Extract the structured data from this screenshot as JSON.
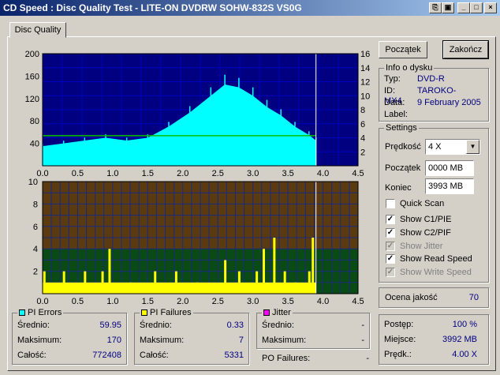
{
  "window": {
    "title": "CD Speed : Disc Quality Test - LITE-ON DVDRW SOHW-832S VS0G"
  },
  "tab": {
    "label": "Disc Quality"
  },
  "buttons": {
    "start": "Początek",
    "stop": "Zakończ"
  },
  "disc_info": {
    "legend": "Info o dysku",
    "type_label": "Typ:",
    "type_value": "DVD-R",
    "id_label": "ID:",
    "id_value": "TAROKO-MX4",
    "date_label": "Data:",
    "date_value": "9 February 2005",
    "label_label": "Label:"
  },
  "settings": {
    "legend": "Settings",
    "speed_label": "Prędkość",
    "speed_value": "4 X",
    "start_label": "Początek",
    "start_value": "0000 MB",
    "end_label": "Koniec",
    "end_value": "3993 MB",
    "quick_scan": "Quick Scan",
    "show_c1": "Show C1/PIE",
    "show_c2": "Show C2/PIF",
    "show_jitter": "Show Jitter",
    "show_read": "Show Read Speed",
    "show_write": "Show Write Speed"
  },
  "quality": {
    "label": "Ocena jakość",
    "value": "70"
  },
  "progress": {
    "progress_label": "Postęp:",
    "progress_value": "100 %",
    "place_label": "Miejsce:",
    "place_value": "3992 MB",
    "speed_label": "Prędk.:",
    "speed_value": "4.00 X"
  },
  "pi_errors": {
    "legend": "PI Errors",
    "avg_label": "Średnio:",
    "avg": "59.95",
    "max_label": "Maksimum:",
    "max": "170",
    "total_label": "Całość:",
    "total": "772408"
  },
  "pi_failures": {
    "legend": "PI Failures",
    "avg_label": "Średnio:",
    "avg": "0.33",
    "max_label": "Maksimum:",
    "max": "7",
    "total_label": "Całość:",
    "total": "5331"
  },
  "jitter": {
    "legend": "Jitter",
    "avg_label": "Średnio:",
    "avg": "-",
    "max_label": "Maksimum:",
    "max": "-",
    "po_label": "PO Failures:",
    "po": "-"
  },
  "colors": {
    "pie": "#00ffff",
    "pif": "#ffff00",
    "jitter": "#ff00ff",
    "speed": "#00c000",
    "top_bg": "#000080",
    "bottom_hi": "#5a3a10",
    "bottom_lo": "#0a4a14"
  },
  "chart_data": [
    {
      "type": "area",
      "x_ticks": [
        "0.0",
        "0.5",
        "1.0",
        "1.5",
        "2.0",
        "2.5",
        "3.0",
        "3.5",
        "4.0",
        "4.5"
      ],
      "y_left_ticks": [
        "200",
        "160",
        "120",
        "80",
        "40"
      ],
      "y_right_ticks": [
        "16",
        "14",
        "12",
        "10",
        "8",
        "6",
        "4",
        "2"
      ],
      "xlim": [
        0,
        4.5
      ],
      "ylim": [
        0,
        200
      ],
      "y2lim": [
        0,
        16
      ],
      "series": [
        {
          "values_x": [
            0.0,
            0.3,
            0.6,
            0.9,
            1.2,
            1.5,
            1.8,
            2.1,
            2.4,
            2.6,
            2.8,
            3.0,
            3.2,
            3.4,
            3.6,
            3.8,
            3.9
          ],
          "values_y": [
            35,
            40,
            45,
            50,
            45,
            50,
            70,
            95,
            125,
            145,
            140,
            125,
            105,
            90,
            70,
            55,
            45
          ]
        },
        {
          "values_x": [
            0.0,
            3.9
          ],
          "values_y": [
            4.3,
            4.3
          ]
        }
      ]
    },
    {
      "type": "bar",
      "x_ticks": [
        "0.0",
        "0.5",
        "1.0",
        "1.5",
        "2.0",
        "2.5",
        "3.0",
        "3.5",
        "4.0",
        "4.5"
      ],
      "y_ticks": [
        "10",
        "8",
        "6",
        "4",
        "2"
      ],
      "xlim": [
        0,
        4.5
      ],
      "ylim": [
        0,
        10
      ],
      "series": [
        {
          "values_x": [
            0.02,
            0.3,
            0.6,
            0.85,
            0.95,
            1.25,
            1.6,
            1.9,
            2.2,
            2.6,
            2.8,
            3.05,
            3.15,
            3.3,
            3.45,
            3.6,
            3.8,
            3.85
          ],
          "values_y": [
            2,
            2,
            2,
            2,
            4,
            1,
            2,
            2,
            1,
            3,
            2,
            2,
            4,
            5,
            2,
            1,
            2,
            5
          ]
        }
      ]
    }
  ]
}
